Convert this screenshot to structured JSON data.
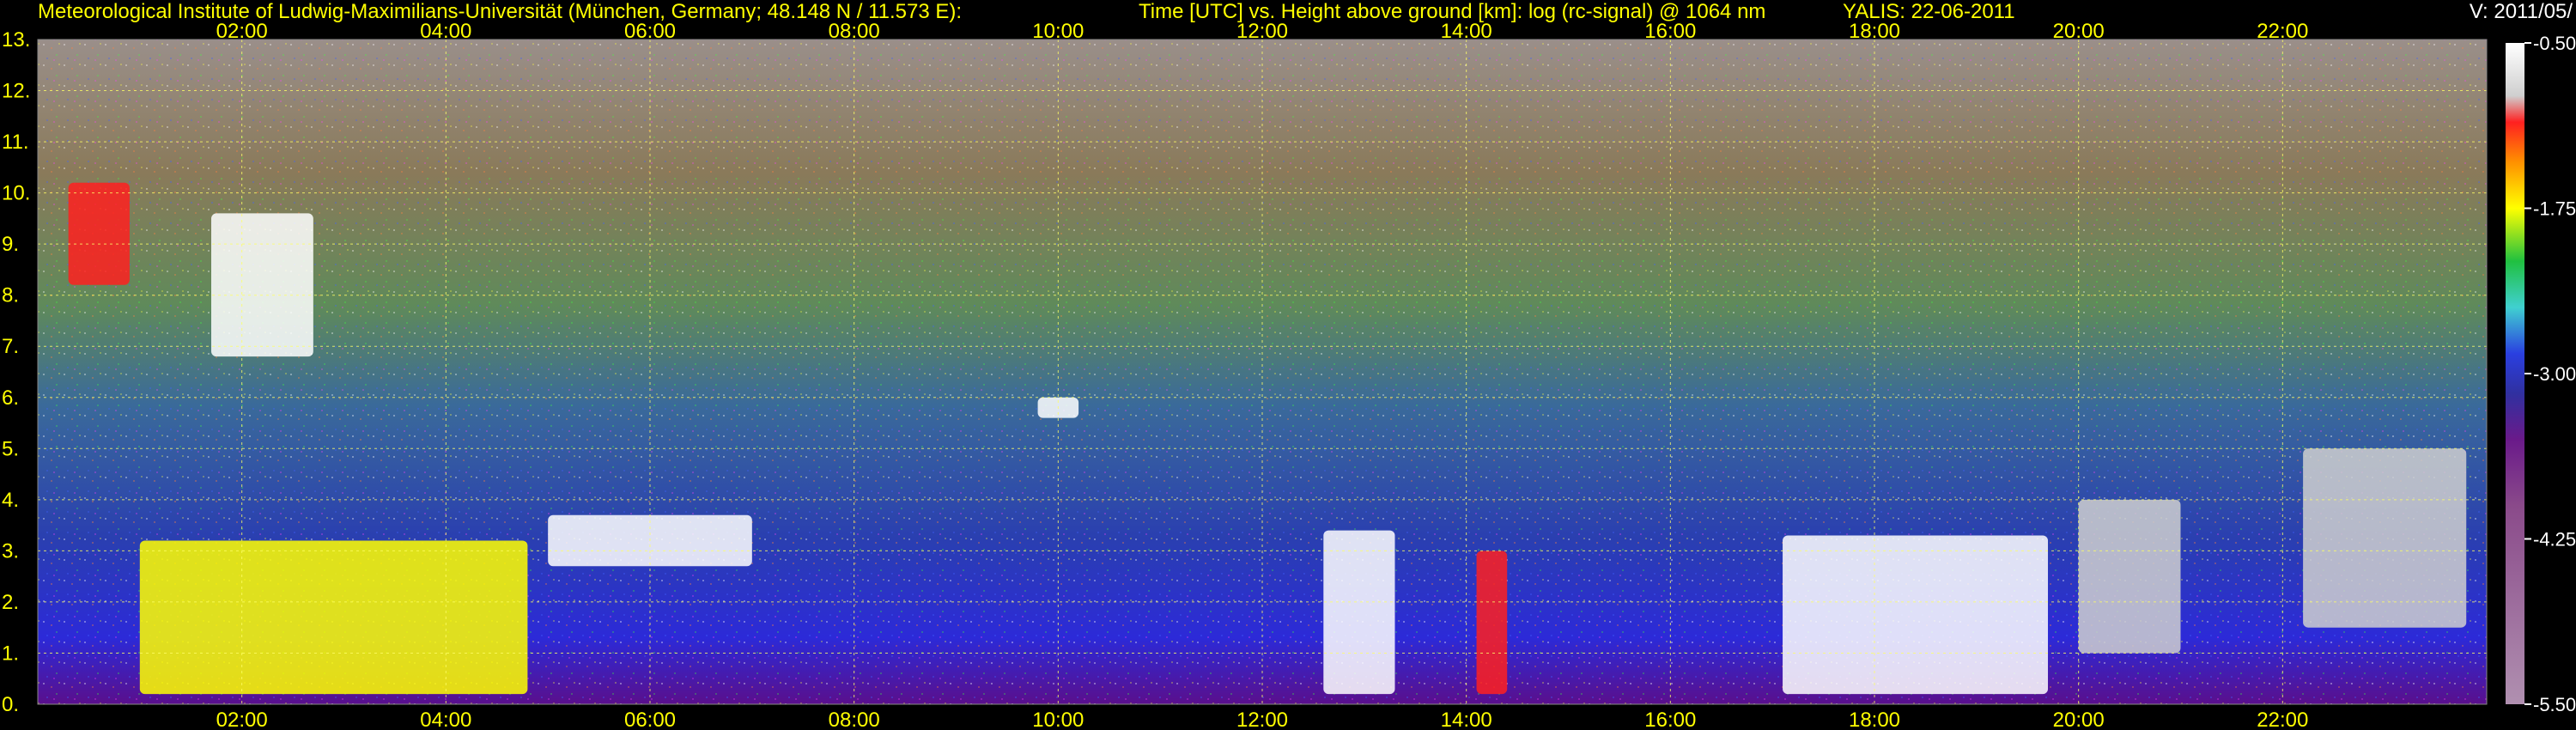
{
  "header": {
    "institute": "Meteorological Institute of Ludwig-Maximilians-Universität (München, Germany; 48.148 N / 11.573 E):",
    "description": "Time [UTC] vs. Height above ground [km]: log (rc-signal) @ 1064 nm",
    "station_date": "YALIS: 22-06-2011",
    "version": "V: 2011/05/"
  },
  "chart_data": {
    "type": "heatmap",
    "title": "Time [UTC] vs. Height above ground [km]: log (rc-signal) @ 1064 nm",
    "xlabel": "",
    "ylabel": "",
    "x_range_hours": [
      0.0,
      24.0
    ],
    "y_range_km": [
      0,
      13
    ],
    "x_ticks": [
      "02:00",
      "04:00",
      "06:00",
      "08:00",
      "10:00",
      "12:00",
      "14:00",
      "16:00",
      "18:00",
      "20:00",
      "22:00"
    ],
    "x_tick_hours": [
      2,
      4,
      6,
      8,
      10,
      12,
      14,
      16,
      18,
      20,
      22
    ],
    "y_ticks": [
      "0.",
      "1.",
      "2.",
      "3.",
      "4.",
      "5.",
      "6.",
      "7.",
      "8.",
      "9.",
      "10.",
      "11.",
      "12.",
      "13."
    ],
    "y_tick_values": [
      0,
      1,
      2,
      3,
      4,
      5,
      6,
      7,
      8,
      9,
      10,
      11,
      12,
      13
    ],
    "grid": true,
    "colorbar": {
      "range": [
        -5.5,
        -0.5
      ],
      "tick_labels": [
        "-0.50",
        "-1.75",
        "-3.00",
        "-4.25",
        "-5.50"
      ],
      "tick_values": [
        -0.5,
        -1.75,
        -3.0,
        -4.25,
        -5.5
      ]
    },
    "features": [
      {
        "kind": "cirrus",
        "t0": 1.7,
        "t1": 2.7,
        "h0": 6.8,
        "h1": 9.6,
        "level": -0.7
      },
      {
        "kind": "cirrus",
        "t0": 0.3,
        "t1": 0.9,
        "h0": 8.2,
        "h1": 10.2,
        "level": -1.3
      },
      {
        "kind": "aerosol_layer",
        "t0": 1.0,
        "t1": 4.8,
        "h0": 0.2,
        "h1": 3.2,
        "level": -2.0
      },
      {
        "kind": "cloud_top",
        "t0": 5.0,
        "t1": 7.0,
        "h0": 2.7,
        "h1": 3.7,
        "level": -0.6
      },
      {
        "kind": "cloud",
        "t0": 9.8,
        "t1": 10.2,
        "h0": 5.6,
        "h1": 6.0,
        "level": -0.5
      },
      {
        "kind": "precip_cloud",
        "t0": 12.6,
        "t1": 13.3,
        "h0": 0.2,
        "h1": 3.4,
        "level": -0.5
      },
      {
        "kind": "precip_cloud",
        "t0": 14.1,
        "t1": 14.4,
        "h0": 0.2,
        "h1": 3.0,
        "level": -1.2
      },
      {
        "kind": "convective_cloud",
        "t0": 17.1,
        "t1": 19.7,
        "h0": 0.2,
        "h1": 3.3,
        "level": -0.5
      },
      {
        "kind": "broken_cloud",
        "t0": 20.0,
        "t1": 21.0,
        "h0": 1.0,
        "h1": 4.0,
        "level": -1.0
      },
      {
        "kind": "broken_cloud",
        "t0": 22.2,
        "t1": 23.8,
        "h0": 1.5,
        "h1": 5.0,
        "level": -1.0
      }
    ]
  },
  "colors": {
    "label": "#ffff00",
    "grid": "#ffff66",
    "background": "#000000"
  }
}
